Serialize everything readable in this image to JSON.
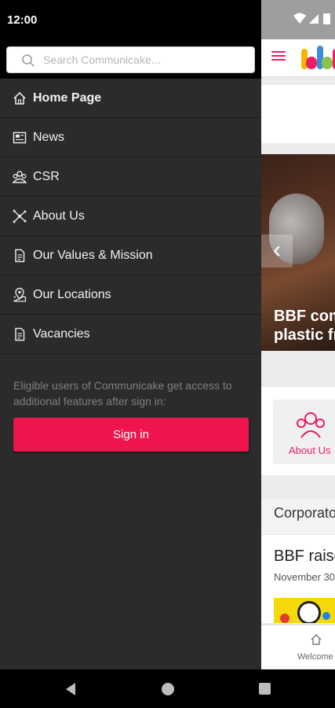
{
  "status_bar": {
    "time": "12:00"
  },
  "search": {
    "placeholder": "Search Communicake..."
  },
  "menu": {
    "items": [
      {
        "label": "Home Page",
        "icon": "home-icon",
        "active": true
      },
      {
        "label": "News",
        "icon": "newspaper-icon"
      },
      {
        "label": "CSR",
        "icon": "people-icon"
      },
      {
        "label": "About Us",
        "icon": "network-icon"
      },
      {
        "label": "Our Values & Mission",
        "icon": "document-icon"
      },
      {
        "label": "Our Locations",
        "icon": "location-icon"
      },
      {
        "label": "Vacancies",
        "icon": "document-icon"
      }
    ]
  },
  "signin": {
    "note": "Eligible users of Communicake get access to additional features after sign in:",
    "button_label": "Sign in"
  },
  "background_app": {
    "hero_text": "BBF com\nplastic fr",
    "tile_label": "About Us",
    "section_title": "Corporato",
    "article_title": "BBF raise",
    "article_date": "November 30",
    "bottom_nav_label": "Welcome"
  },
  "colors": {
    "accent": "#f0144e",
    "drawer_bg": "#2b2b2b"
  }
}
